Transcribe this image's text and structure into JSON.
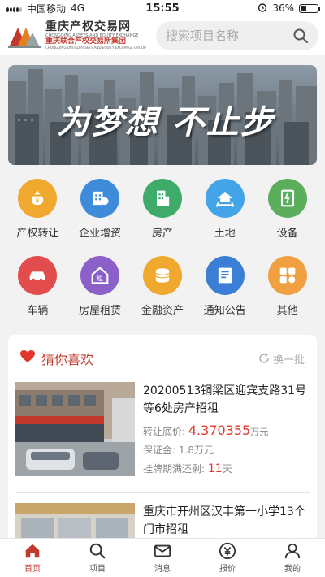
{
  "status": {
    "carrier": "中国移动",
    "network": "4G",
    "time": "15:55",
    "battery": "36%",
    "battery_level": 0.36
  },
  "header": {
    "logo_title": "重庆产权交易网",
    "logo_title_en": "CHONGQING ASSETS AND EQUITY EXCHANGE",
    "logo_subtitle": "重庆联合产权交易所集团",
    "logo_subtitle_en": "CHONGQING UNITED ASSETS AND EQUITY EXCHANGE GROUP",
    "search_placeholder": "搜索项目名称"
  },
  "banner": {
    "caption": "为梦想 不止步"
  },
  "categories": [
    {
      "label": "产权转让",
      "icon": "money-bag-icon",
      "color": "#f0a92e"
    },
    {
      "label": "企业增资",
      "icon": "capital-increase-icon",
      "color": "#3e8cd9"
    },
    {
      "label": "房产",
      "icon": "building-icon",
      "color": "#3eab6b"
    },
    {
      "label": "土地",
      "icon": "land-icon",
      "color": "#43a4e8"
    },
    {
      "label": "设备",
      "icon": "equipment-icon",
      "color": "#5bae5b"
    },
    {
      "label": "车辆",
      "icon": "car-icon",
      "color": "#e24c4c"
    },
    {
      "label": "房屋租赁",
      "icon": "house-rent-icon",
      "color": "#8b60c9"
    },
    {
      "label": "金融资产",
      "icon": "coins-icon",
      "color": "#f0a92e"
    },
    {
      "label": "通知公告",
      "icon": "notice-icon",
      "color": "#3a7fd5"
    },
    {
      "label": "其他",
      "icon": "other-icon",
      "color": "#f0a040"
    }
  ],
  "recommend": {
    "title": "猜你喜欢",
    "refresh": "换一批",
    "items": [
      {
        "name": "20200513铜梁区迎宾支路31号等6处房产招租",
        "price_label": "转让底价:",
        "price": "4.370355",
        "price_unit": "万元",
        "deposit_label": "保证金:",
        "deposit": "1.8万元",
        "remain_label": "挂牌期满还剩:",
        "remain_days": "11",
        "remain_unit": "天"
      },
      {
        "name": "重庆市开州区汉丰第一小学13个门市招租"
      }
    ]
  },
  "tabs": [
    {
      "label": "首页",
      "icon": "home-icon"
    },
    {
      "label": "项目",
      "icon": "search-icon"
    },
    {
      "label": "消息",
      "icon": "message-icon"
    },
    {
      "label": "报价",
      "icon": "bid-icon"
    },
    {
      "label": "我的",
      "icon": "user-icon"
    }
  ]
}
